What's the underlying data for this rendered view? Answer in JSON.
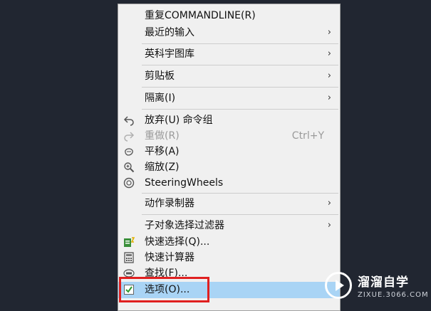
{
  "menu": {
    "items": [
      {
        "label": "重复COMMANDLINE(R)"
      },
      {
        "label": "最近的输入",
        "arrow": "›"
      },
      {
        "label": "英科宇图库",
        "arrow": "›"
      },
      {
        "label": "剪贴板",
        "arrow": "›"
      },
      {
        "label": "隔离(I)",
        "arrow": "›"
      },
      {
        "label": "放弃(U) 命令组",
        "icon": "undo-icon"
      },
      {
        "label": "重做(R)",
        "shortcut": "Ctrl+Y",
        "icon": "redo-icon",
        "disabled": true
      },
      {
        "label": "平移(A)",
        "icon": "pan-hand-icon"
      },
      {
        "label": "缩放(Z)",
        "icon": "zoom-icon"
      },
      {
        "label": "SteeringWheels",
        "icon": "steering-wheel-icon"
      },
      {
        "label": "动作录制器",
        "arrow": "›"
      },
      {
        "label": "子对象选择过滤器",
        "arrow": "›"
      },
      {
        "label": "快速选择(Q)...",
        "icon": "quick-select-icon"
      },
      {
        "label": "快速计算器",
        "icon": "calculator-icon"
      },
      {
        "label": "查找(F)...",
        "icon": "find-abc-icon"
      },
      {
        "label": "选项(O)...",
        "icon": "checkbox-icon",
        "highlighted": true
      }
    ]
  },
  "watermark": {
    "title": "溜溜自学",
    "url": "ZIXUE.3066.COM"
  },
  "colors": {
    "background": "#212631",
    "menu_bg": "#f0f0f0",
    "highlight": "#a9d4f5",
    "annotation": "#e02020"
  }
}
